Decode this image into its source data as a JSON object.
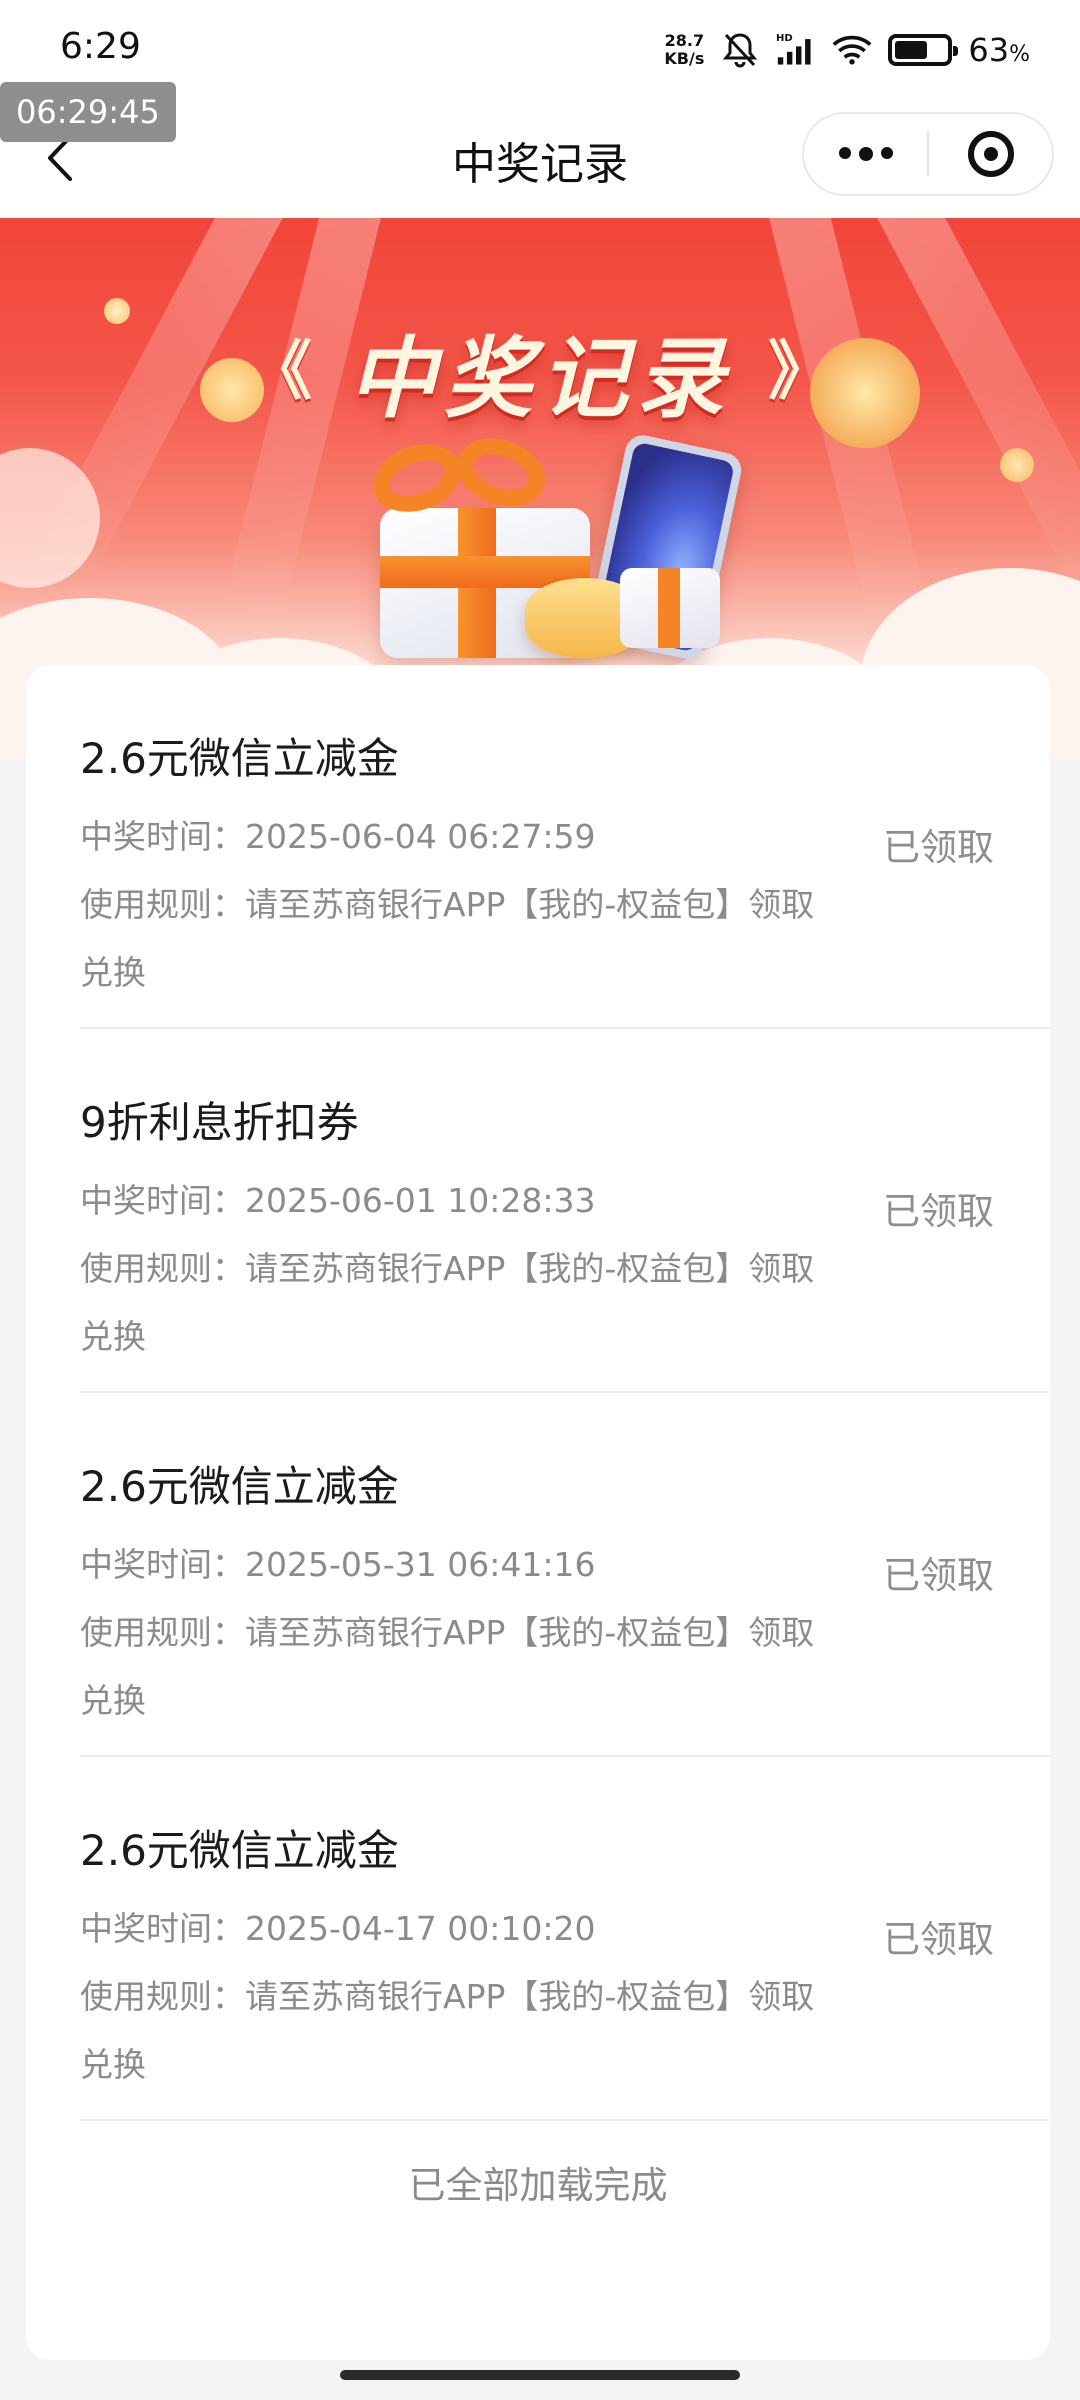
{
  "status_bar": {
    "time": "6:29",
    "net_speed_value": "28.7",
    "net_speed_unit": "KB/s",
    "hd_label": "HD",
    "battery_percent": "63",
    "battery_percent_sign": "%",
    "battery_level": 0.63
  },
  "overlay_timestamp": "06:29:45",
  "nav": {
    "title": "中奖记录"
  },
  "banner": {
    "title": "中奖记录",
    "left_deco": "《",
    "right_deco": "》"
  },
  "records": [
    {
      "title": "2.6元微信立减金",
      "time_label": "中奖时间：",
      "time_value": "2025-06-04 06:27:59",
      "rule_label": "使用规则：",
      "rule_value": "请至苏商银行APP【我的-权益包】领取兑换",
      "status": "已领取"
    },
    {
      "title": "9折利息折扣券",
      "time_label": "中奖时间：",
      "time_value": "2025-06-01 10:28:33",
      "rule_label": "使用规则：",
      "rule_value": "请至苏商银行APP【我的-权益包】领取兑换",
      "status": "已领取"
    },
    {
      "title": "2.6元微信立减金",
      "time_label": "中奖时间：",
      "time_value": "2025-05-31 06:41:16",
      "rule_label": "使用规则：",
      "rule_value": "请至苏商银行APP【我的-权益包】领取兑换",
      "status": "已领取"
    },
    {
      "title": "2.6元微信立减金",
      "time_label": "中奖时间：",
      "time_value": "2025-04-17 00:10:20",
      "rule_label": "使用规则：",
      "rule_value": "请至苏商银行APP【我的-权益包】领取兑换",
      "status": "已领取"
    }
  ],
  "footer": {
    "load_complete": "已全部加载完成"
  },
  "colors": {
    "banner_red": "#f2453a",
    "title_gold": "#fff6e2",
    "text_primary": "#1b1b1b",
    "text_secondary": "#8b8b8b"
  }
}
